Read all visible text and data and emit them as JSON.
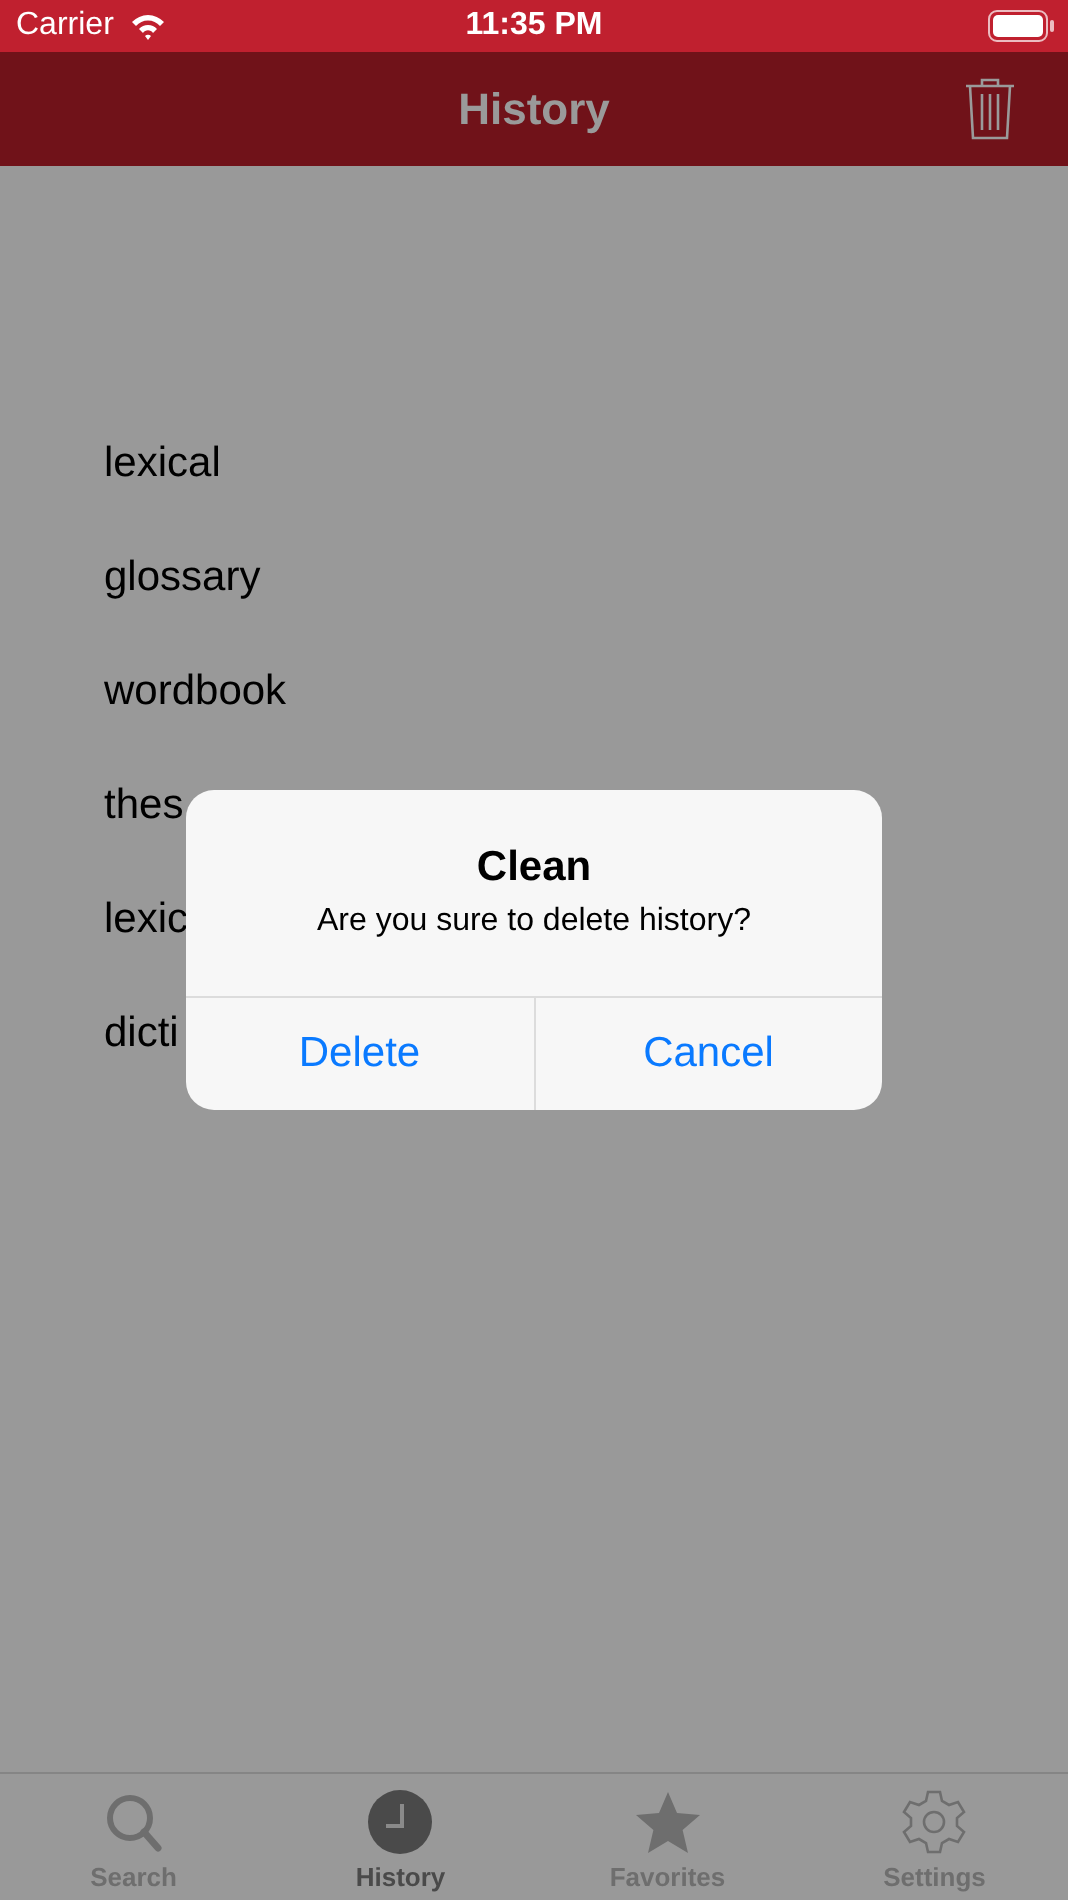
{
  "status_bar": {
    "carrier": "Carrier",
    "time": "11:35 PM"
  },
  "nav_bar": {
    "title": "History"
  },
  "history": [
    {
      "word": "lexical"
    },
    {
      "word": "glossary"
    },
    {
      "word": "wordbook"
    },
    {
      "word": "thes"
    },
    {
      "word": "lexic"
    },
    {
      "word": "dicti"
    }
  ],
  "alert": {
    "title": "Clean",
    "message": "Are you sure to delete history?",
    "buttons": [
      "Delete",
      "Cancel"
    ]
  },
  "tabs": [
    {
      "label": "Search",
      "kind": "search",
      "selected": false
    },
    {
      "label": "History",
      "kind": "history",
      "selected": true
    },
    {
      "label": "Favorites",
      "kind": "favorites",
      "selected": false
    },
    {
      "label": "Settings",
      "kind": "settings",
      "selected": false
    }
  ]
}
